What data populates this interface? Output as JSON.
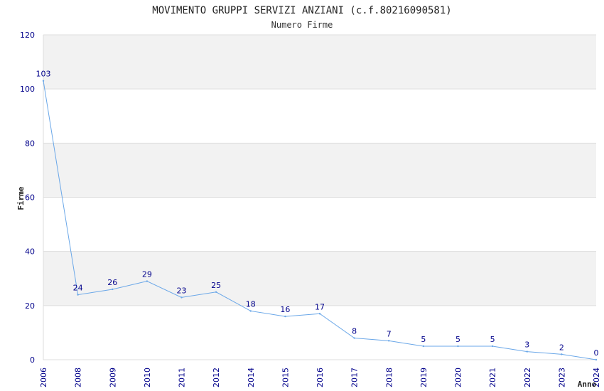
{
  "chart_data": {
    "type": "line",
    "title": "MOVIMENTO GRUPPI SERVIZI ANZIANI (c.f.80216090581)",
    "subtitle": "Numero Firme",
    "xlabel": "Anno",
    "ylabel": "Firme",
    "categories": [
      "2006",
      "2008",
      "2009",
      "2010",
      "2011",
      "2012",
      "2014",
      "2015",
      "2016",
      "2017",
      "2018",
      "2019",
      "2020",
      "2021",
      "2022",
      "2023",
      "2024"
    ],
    "values": [
      103,
      24,
      26,
      29,
      23,
      25,
      18,
      16,
      17,
      8,
      7,
      5,
      5,
      5,
      3,
      2,
      0
    ],
    "ylim": [
      0,
      120
    ],
    "yticks": [
      0,
      20,
      40,
      60,
      80,
      100,
      120
    ],
    "grid": true,
    "colors": {
      "line": "#6aa7e8",
      "band": "#f2f2f2",
      "gridline": "#dddddd",
      "tick_text": "#00008b"
    }
  }
}
